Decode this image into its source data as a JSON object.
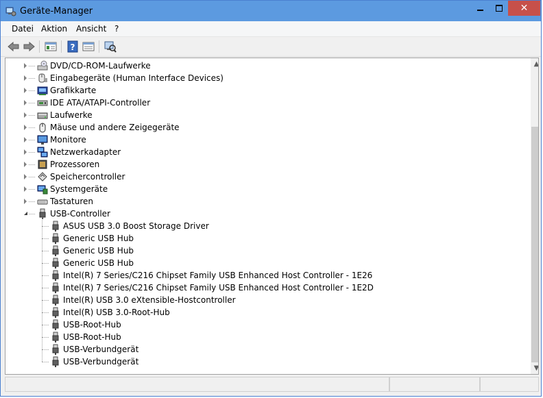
{
  "window": {
    "title": "Geräte-Manager",
    "close_glyph": "✕"
  },
  "menu": {
    "items": [
      "Datei",
      "Aktion",
      "Ansicht",
      "?"
    ]
  },
  "toolbar": {
    "buttons": [
      "back-icon",
      "forward-icon",
      "properties-icon",
      "help-icon",
      "view-icon",
      "scan-hardware-icon"
    ]
  },
  "tree": {
    "categories": [
      {
        "label": "DVD/CD-ROM-Laufwerke",
        "icon": "dvd-drive-icon",
        "expanded": false
      },
      {
        "label": "Eingabegeräte (Human Interface Devices)",
        "icon": "hid-icon",
        "expanded": false
      },
      {
        "label": "Grafikkarte",
        "icon": "graphics-card-icon",
        "expanded": false
      },
      {
        "label": "IDE ATA/ATAPI-Controller",
        "icon": "ide-controller-icon",
        "expanded": false
      },
      {
        "label": "Laufwerke",
        "icon": "disk-drive-icon",
        "expanded": false
      },
      {
        "label": "Mäuse und andere Zeigegeräte",
        "icon": "mouse-icon",
        "expanded": false
      },
      {
        "label": "Monitore",
        "icon": "monitor-icon",
        "expanded": false
      },
      {
        "label": "Netzwerkadapter",
        "icon": "network-adapter-icon",
        "expanded": false
      },
      {
        "label": "Prozessoren",
        "icon": "processor-icon",
        "expanded": false
      },
      {
        "label": "Speichercontroller",
        "icon": "storage-controller-icon",
        "expanded": false
      },
      {
        "label": "Systemgeräte",
        "icon": "system-devices-icon",
        "expanded": false
      },
      {
        "label": "Tastaturen",
        "icon": "keyboard-icon",
        "expanded": false
      },
      {
        "label": "USB-Controller",
        "icon": "usb-icon",
        "expanded": true
      }
    ],
    "usb_children": [
      "ASUS USB 3.0 Boost Storage Driver",
      "Generic USB Hub",
      "Generic USB Hub",
      "Generic USB Hub",
      "Intel(R) 7 Series/C216 Chipset Family USB Enhanced Host Controller - 1E26",
      "Intel(R) 7 Series/C216 Chipset Family USB Enhanced Host Controller - 1E2D",
      "Intel(R) USB 3.0 eXtensible-Hostcontroller",
      "Intel(R) USB 3.0-Root-Hub",
      "USB-Root-Hub",
      "USB-Root-Hub",
      "USB-Verbundgerät",
      "USB-Verbundgerät"
    ]
  },
  "colors": {
    "titlebar": "#5c9ae0",
    "close_button": "#c7504a",
    "border": "#4a7fd0"
  }
}
